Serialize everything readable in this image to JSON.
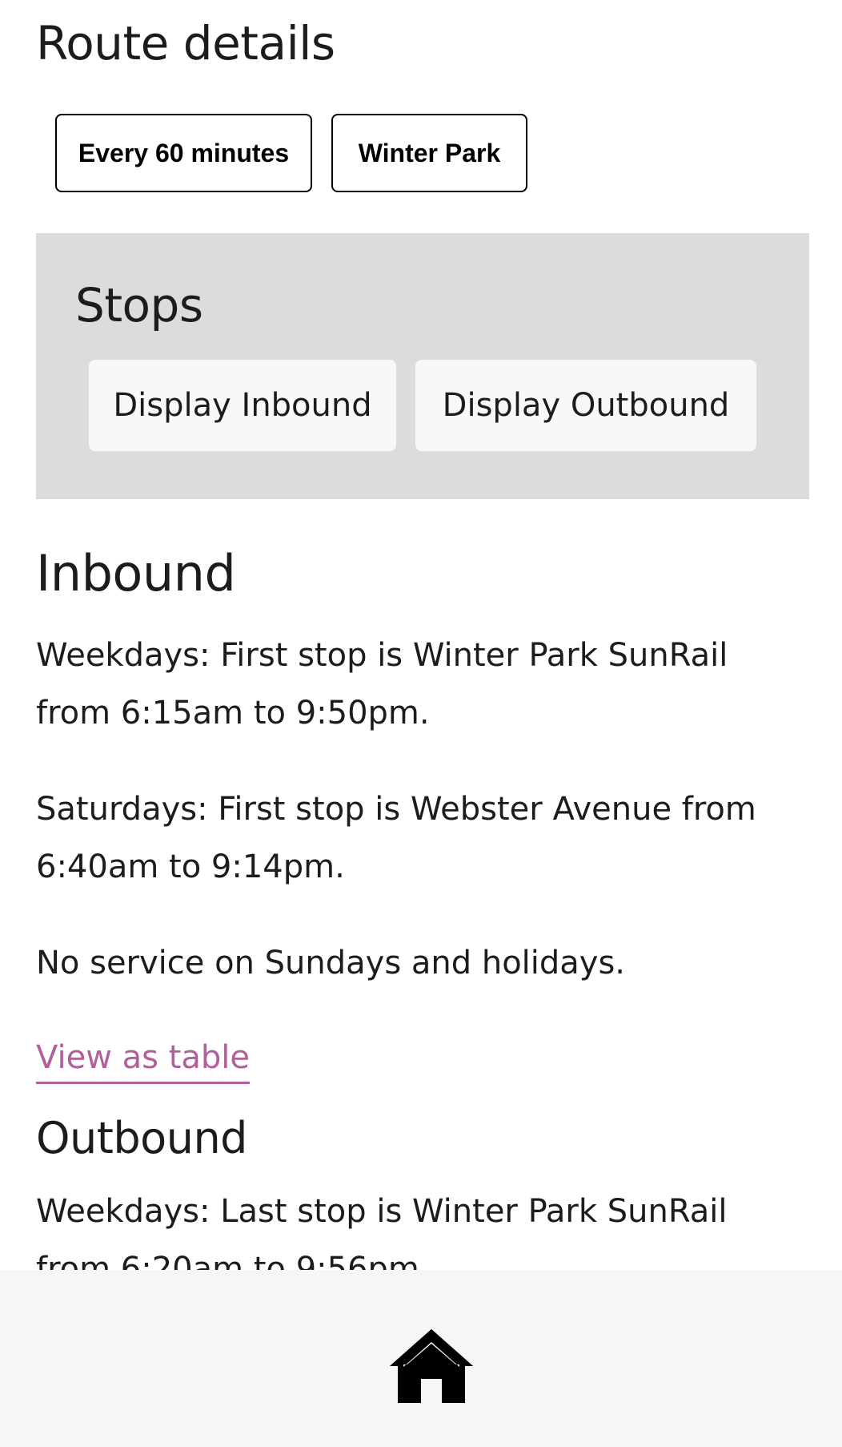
{
  "page": {
    "title": "Route details"
  },
  "route": {
    "frequency_label": "Every 60 minutes",
    "destination_label": "Winter Park"
  },
  "stops": {
    "title": "Stops",
    "inbound_button": "Display Inbound",
    "outbound_button": "Display Outbound"
  },
  "inbound": {
    "title": "Inbound",
    "weekdays": "Weekdays: First stop is Winter Park SunRail from 6:15am to 9:50pm.",
    "saturdays": "Saturdays: First stop is Webster Avenue from 6:40am to 9:14pm.",
    "no_service": "No service on Sundays and holidays.",
    "view_table_link": "View as table"
  },
  "outbound": {
    "title": "Outbound",
    "weekdays": "Weekdays: Last stop is Winter Park SunRail from 6:20am to 9:56pm."
  },
  "bottom_nav": {
    "home_icon": "home-icon"
  },
  "colors": {
    "link": "#b1609a",
    "stops_panel_bg": "#dcdcdc",
    "button_bg": "#f7f8fa",
    "bottom_bar_bg": "#f6f6f7"
  }
}
